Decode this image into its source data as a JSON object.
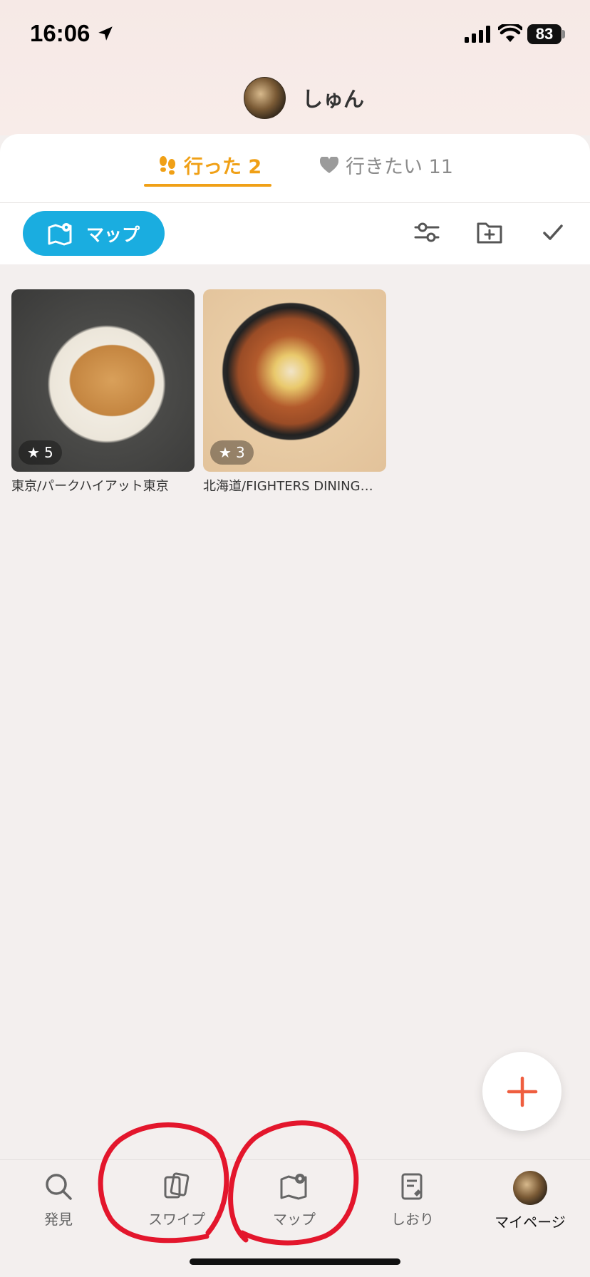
{
  "status_bar": {
    "time": "16:06",
    "battery": "83"
  },
  "profile": {
    "username": "しゅん"
  },
  "tabs": [
    {
      "label": "行った 2",
      "icon": "footprints-icon",
      "active": true
    },
    {
      "label": "行きたい 11",
      "icon": "heart-icon",
      "active": false
    }
  ],
  "toolbar": {
    "map_label": "マップ"
  },
  "places": [
    {
      "caption": "東京/パークハイアット東京",
      "rating": "5"
    },
    {
      "caption": "北海道/FIGHTERS DINING…",
      "rating": "3"
    }
  ],
  "bottom_nav": [
    {
      "label": "発見",
      "icon": "search-icon"
    },
    {
      "label": "スワイプ",
      "icon": "cards-icon"
    },
    {
      "label": "マップ",
      "icon": "map-pin-icon"
    },
    {
      "label": "しおり",
      "icon": "bookmark-note-icon"
    },
    {
      "label": "マイページ",
      "icon": "avatar"
    }
  ],
  "colors": {
    "accent_orange": "#f0a016",
    "map_blue": "#1aade0",
    "fab_plus": "#ef5e3f",
    "annotation_red": "#e3162c"
  }
}
